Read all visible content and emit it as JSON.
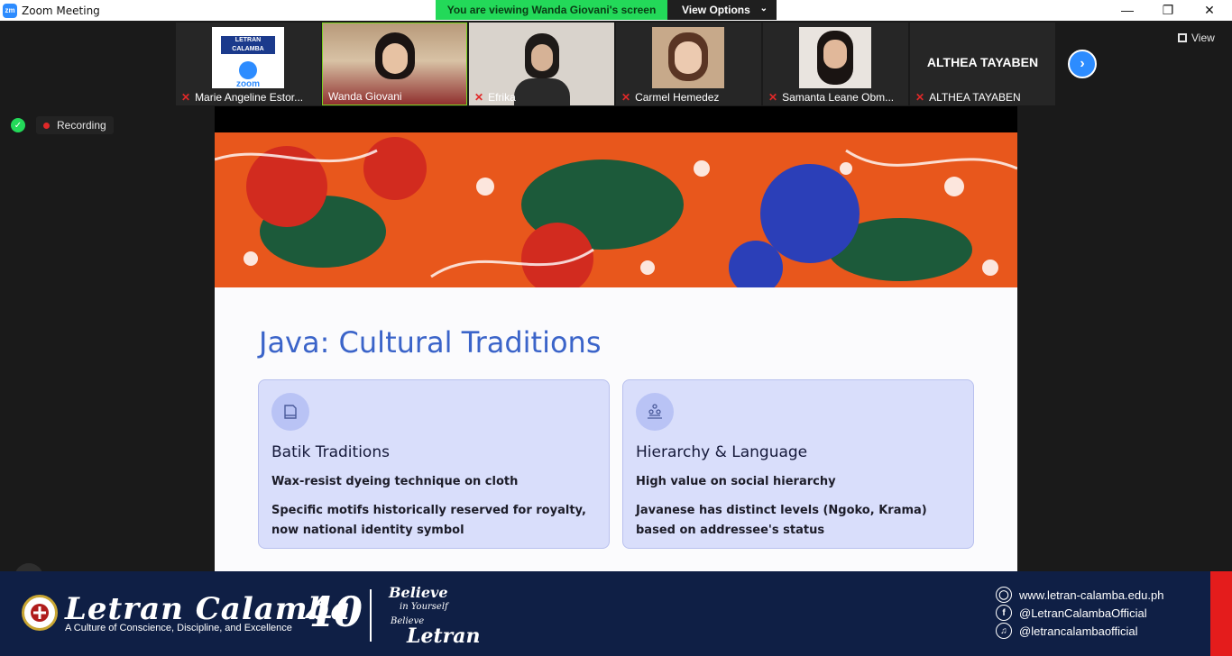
{
  "window": {
    "app_icon": "zm",
    "title": "Zoom Meeting",
    "banner": "You are viewing Wanda Giovani's screen",
    "view_options": "View Options",
    "controls": [
      "minimize-icon",
      "restore-icon",
      "close-icon"
    ]
  },
  "gallery": {
    "participants": [
      {
        "name": "Marie Angeline Estor...",
        "muted": true,
        "tile": "logo",
        "logo_top": "LETRAN CALAMBA",
        "logo_bottom": "zoom"
      },
      {
        "name": "Wanda Giovani",
        "muted": false,
        "active": true,
        "tile": "video"
      },
      {
        "name": "Efrika",
        "muted": true,
        "tile": "video"
      },
      {
        "name": "Carmel Hemedez",
        "muted": true,
        "tile": "video"
      },
      {
        "name": "Samanta Leane Obm...",
        "muted": true,
        "tile": "video"
      },
      {
        "name": "ALTHEA TAYABEN",
        "muted": true,
        "tile": "name",
        "display": "ALTHEA TAYABEN"
      }
    ],
    "next_icon": "chevron-right-icon",
    "view_label": "View"
  },
  "status": {
    "recording": "Recording",
    "security_color": "#23d959",
    "recording_color": "#e02828"
  },
  "slide": {
    "title": "Java: Cultural Traditions",
    "cards": [
      {
        "icon": "book-icon",
        "title": "Batik Traditions",
        "line1": "Wax-resist dyeing technique on cloth",
        "line2": "Specific motifs historically reserved for royalty, now national identity symbol"
      },
      {
        "icon": "hierarchy-icon",
        "title": "Hierarchy & Language",
        "line1": "High value on social hierarchy",
        "line2": "Javanese has distinct levels (Ngoko, Krama) based on addressee's status"
      }
    ],
    "title_color": "#3b64c9",
    "card_color": "#d9defb"
  },
  "footer": {
    "brand": "Letran Calamba",
    "tagline": "A Culture of Conscience, Discipline, and Excellence",
    "anniversary": "40",
    "believe_1": "Believe",
    "believe_2": "in Yourself",
    "believe_3": "Believe",
    "believe_4": "Letran",
    "website": "www.letran-calamba.edu.ph",
    "facebook": "@LetranCalambaOfficial",
    "tiktok": "@letrancalambaofficial",
    "bg_color": "#0f1f45",
    "accent_color": "#e41c1c"
  }
}
